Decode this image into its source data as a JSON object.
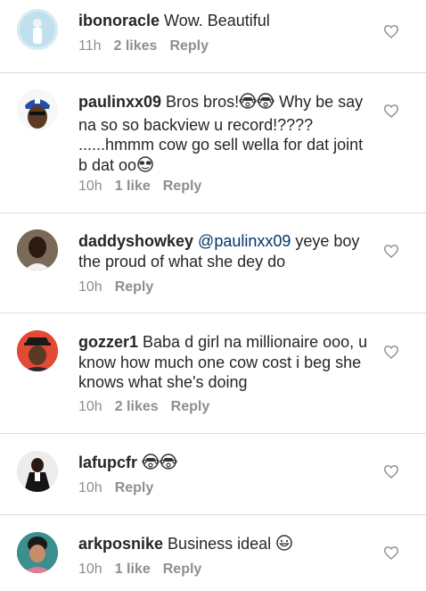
{
  "comments": [
    {
      "username": "ibonoracle",
      "text": "Wow. Beautiful",
      "time": "11h",
      "likes": "2 likes",
      "reply": "Reply"
    },
    {
      "username": "paulinxx09",
      "text1": "Bros bros!",
      "text2": " Why be say na so so backview u record!???? ......hmmm cow go sell wella for dat joint b dat oo",
      "time": "10h",
      "likes": "1 like",
      "reply": "Reply"
    },
    {
      "username": "daddyshowkey",
      "mention": "@paulinxx09",
      "text": " yeye boy the proud of what she dey do",
      "time": "10h",
      "reply": "Reply"
    },
    {
      "username": "gozzer1",
      "text": "Baba d girl na millionaire ooo, u know how much one cow cost i beg she knows what she's doing",
      "time": "10h",
      "likes": "2 likes",
      "reply": "Reply"
    },
    {
      "username": "lafupcfr",
      "time": "10h",
      "reply": "Reply"
    },
    {
      "username": "arkposnike",
      "text": "Business ideal",
      "time": "10h",
      "likes": "1 like",
      "reply": "Reply"
    }
  ],
  "icons": {
    "like": "heart-outline-icon"
  },
  "colors": {
    "text": "#262626",
    "muted": "#8e8e8e",
    "mention": "#003569",
    "divider": "#dbdbdb"
  }
}
